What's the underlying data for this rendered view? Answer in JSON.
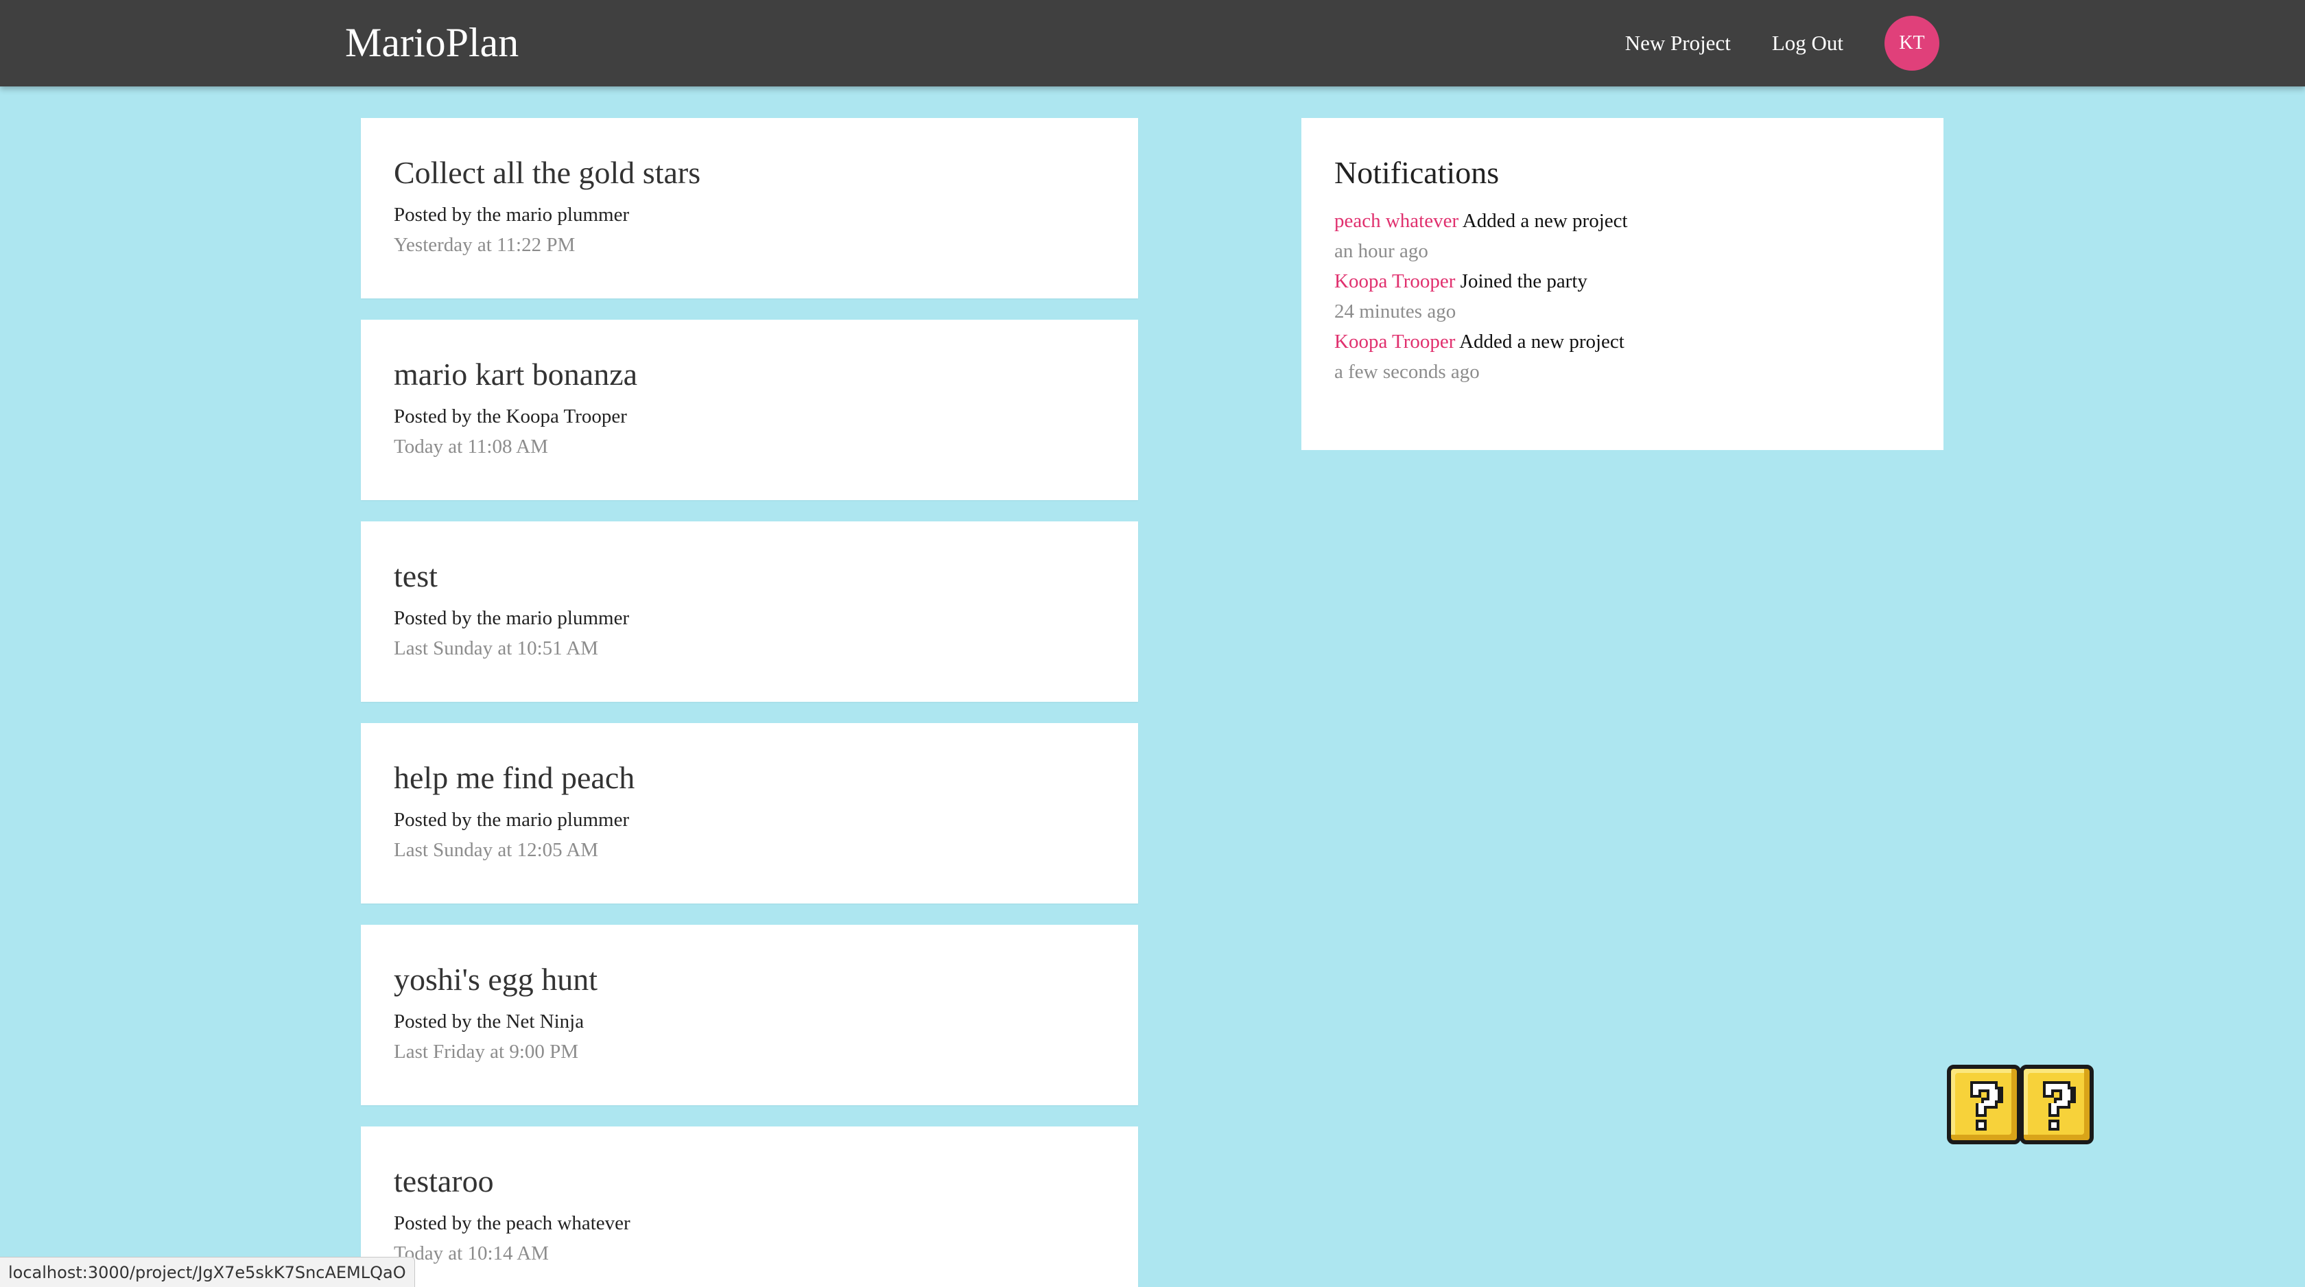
{
  "navbar": {
    "brand": "MarioPlan",
    "links": {
      "new_project": "New Project",
      "log_out": "Log Out"
    },
    "avatar_initials": "KT",
    "avatar_color": "#e0407a"
  },
  "projects": [
    {
      "title": "Collect all the gold stars",
      "author": "Posted by the mario plummer",
      "date": "Yesterday at 11:22 PM"
    },
    {
      "title": "mario kart bonanza",
      "author": "Posted by the Koopa Trooper",
      "date": "Today at 11:08 AM"
    },
    {
      "title": "test",
      "author": "Posted by the mario plummer",
      "date": "Last Sunday at 10:51 AM"
    },
    {
      "title": "help me find peach",
      "author": "Posted by the mario plummer",
      "date": "Last Sunday at 12:05 AM"
    },
    {
      "title": "yoshi's egg hunt",
      "author": "Posted by the Net Ninja",
      "date": "Last Friday at 9:00 PM"
    },
    {
      "title": "testaroo",
      "author": "Posted by the peach whatever",
      "date": "Today at 10:14 AM"
    }
  ],
  "notifications": {
    "title": "Notifications",
    "items": [
      {
        "user": "peach whatever",
        "message": "Added a new project",
        "time": "an hour ago"
      },
      {
        "user": "Koopa Trooper",
        "message": "Joined the party",
        "time": "24 minutes ago"
      },
      {
        "user": "Koopa Trooper",
        "message": "Added a new project",
        "time": "a few seconds ago"
      }
    ]
  },
  "status_bar": {
    "url": "localhost:3000/project/JgX7e5skK7SncAEMLQaO"
  },
  "colors": {
    "background": "#ade6f0",
    "navbar": "#404040",
    "accent_pink": "#e0306e",
    "block_yellow": "#f7d23a"
  }
}
